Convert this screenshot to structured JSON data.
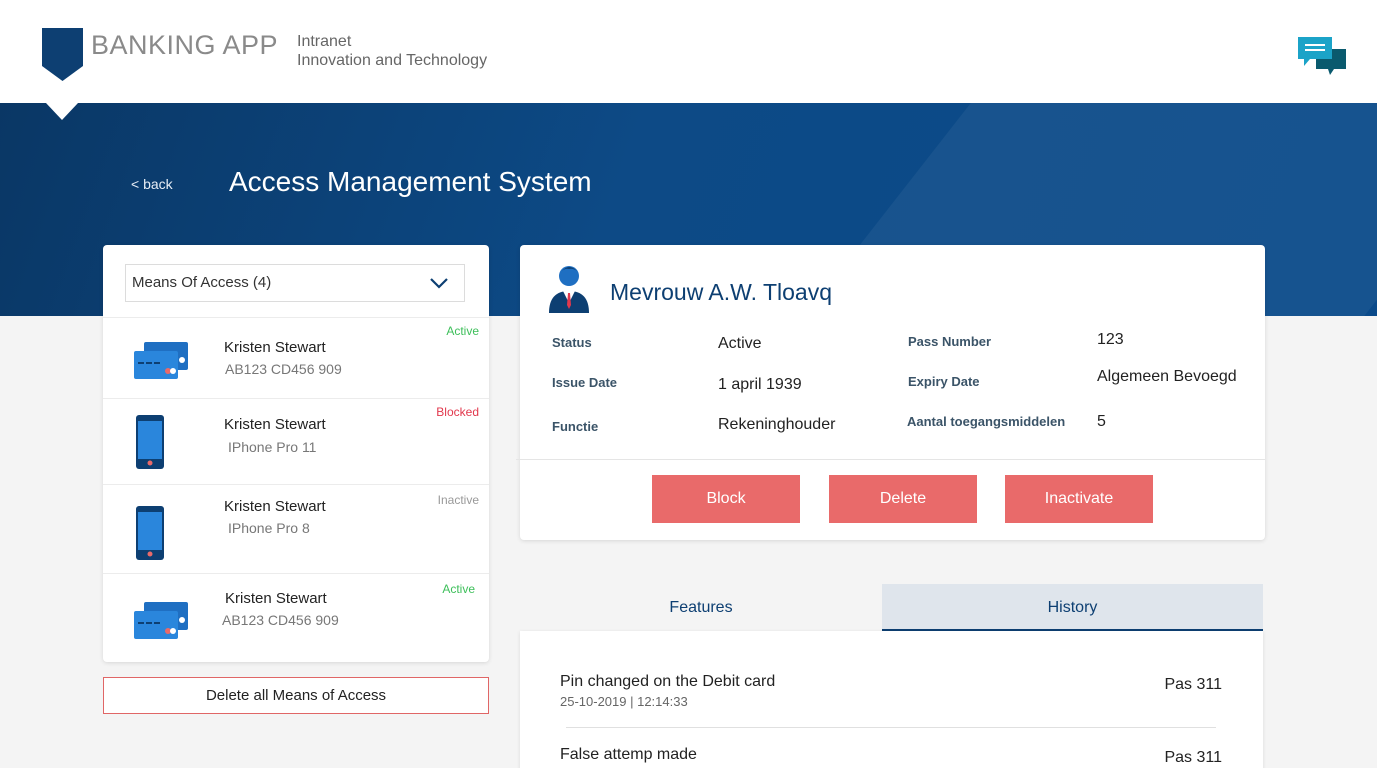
{
  "header": {
    "brand": "BANKING APP",
    "intranet_line1": "Intranet",
    "intranet_line2": "Innovation and Technology",
    "chat_icon": "chat-bubbles-icon"
  },
  "hero": {
    "back_label": "< back",
    "title": "Access Management System"
  },
  "means_of_access": {
    "dropdown_label": "Means Of Access (4)",
    "items": [
      {
        "name": "Kristen Stewart",
        "sub": "AB123 CD456 909",
        "status": "Active",
        "icon": "credit-cards-icon"
      },
      {
        "name": "Kristen Stewart",
        "sub": "IPhone Pro 11",
        "status": "Blocked",
        "icon": "smartphone-icon"
      },
      {
        "name": "Kristen Stewart",
        "sub": "IPhone Pro 8",
        "status": "Inactive",
        "icon": "smartphone-icon"
      },
      {
        "name": "Kristen Stewart",
        "sub": "AB123 CD456 909",
        "status": "Active",
        "icon": "credit-cards-icon"
      }
    ],
    "delete_all_label": "Delete all Means of Access"
  },
  "detail": {
    "name": "Mevrouw A.W. Tloavq",
    "fields": {
      "status_label": "Status",
      "status_value": "Active",
      "issue_label": "Issue Date",
      "issue_value": "1 april 1939",
      "functie_label": "Functie",
      "functie_value": "Rekeninghouder",
      "pass_label": "Pass Number",
      "pass_value": "123",
      "expiry_label": "Expiry Date",
      "expiry_value": "Algemeen Bevoegd",
      "aantal_label": "Aantal toegangsmiddelen",
      "aantal_value": "5"
    },
    "actions": {
      "block": "Block",
      "delete": "Delete",
      "inactivate": "Inactivate"
    }
  },
  "tabs": {
    "features": "Features",
    "history": "History",
    "active": "History"
  },
  "history": [
    {
      "title": "Pin changed on the Debit card",
      "date": "25-10-2019  |  12:14:33",
      "pass": "Pas 311"
    },
    {
      "title": "False attemp made",
      "date": "",
      "pass": "Pas 311"
    }
  ],
  "colors": {
    "primary": "#0d3f72",
    "danger": "#e96a6a",
    "active": "#3dbf5a",
    "blocked": "#e2384d"
  }
}
